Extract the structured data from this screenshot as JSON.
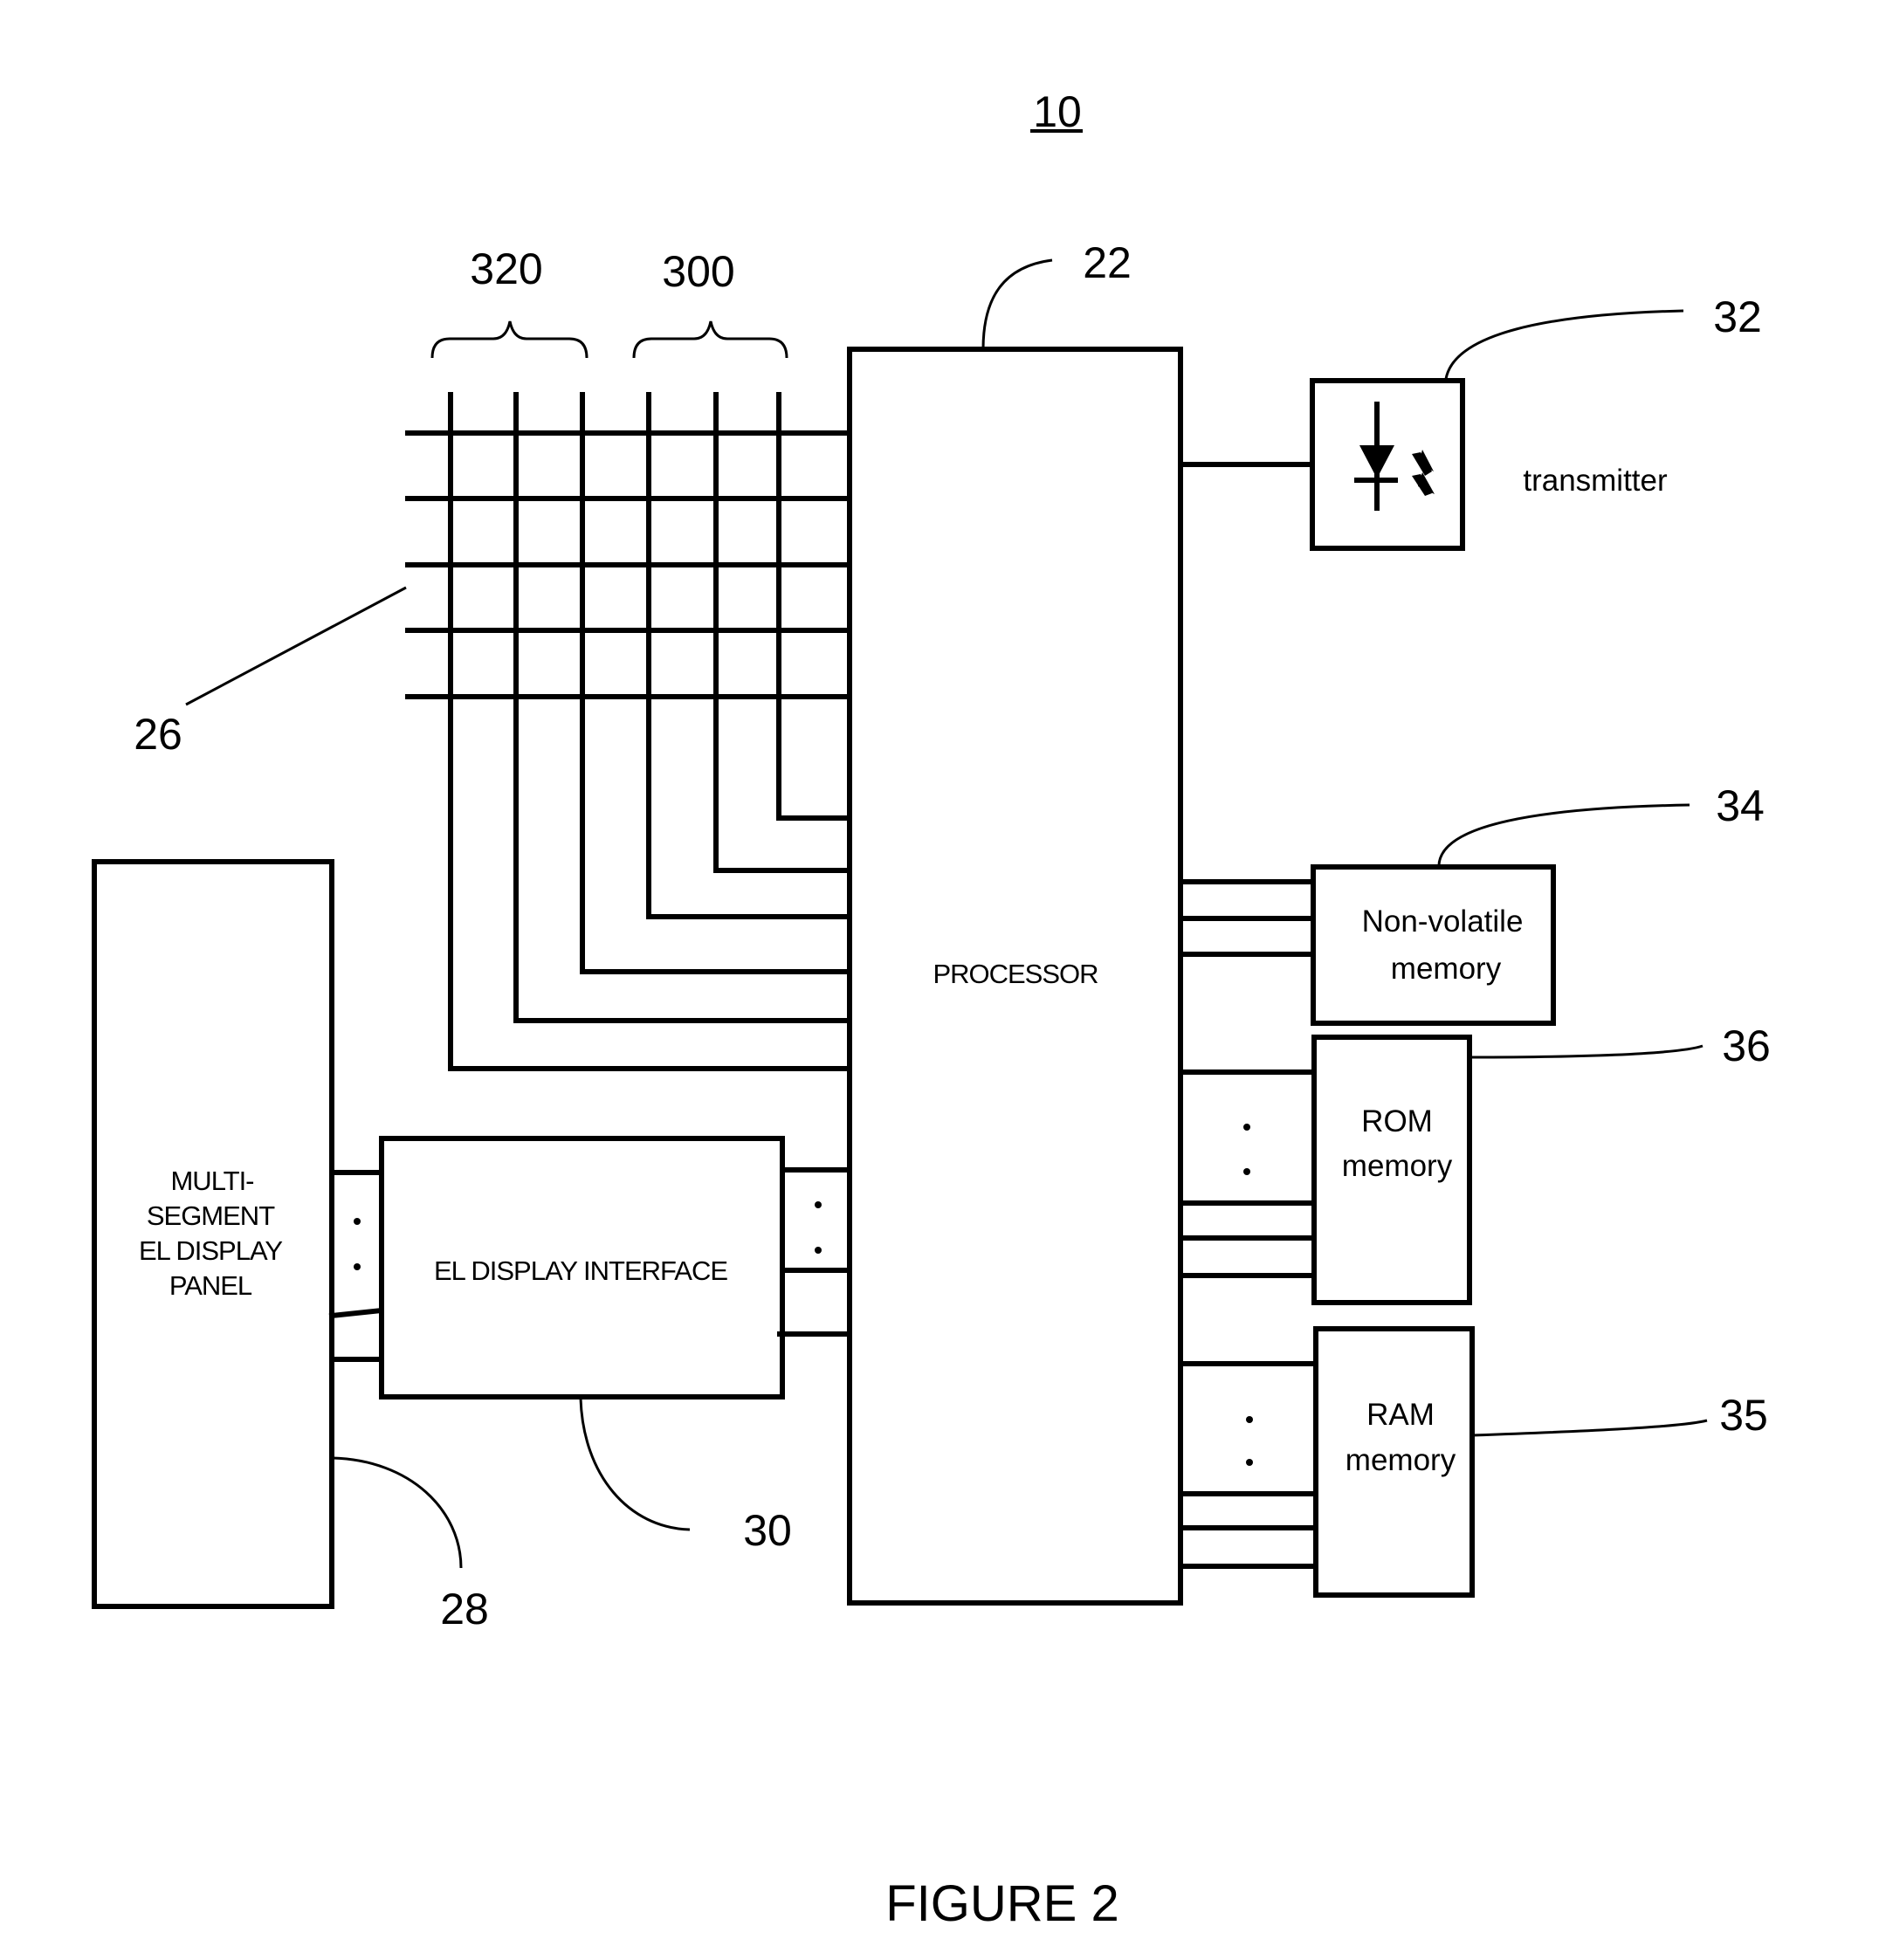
{
  "figure": {
    "reference_number": "10",
    "caption": "FIGURE 2"
  },
  "bus_groups": [
    {
      "ref": "320",
      "line_count": 3
    },
    {
      "ref": "300",
      "line_count": 3
    }
  ],
  "grid": {
    "ref": "26",
    "row_count": 5
  },
  "processor": {
    "ref": "22",
    "label": "PROCESSOR"
  },
  "transmitter": {
    "ref": "32",
    "label": "transmitter",
    "icon": "led-diode-icon"
  },
  "nonvolatile_memory": {
    "ref": "34",
    "label_lines": [
      "Non-volatile",
      "memory"
    ]
  },
  "rom_memory": {
    "ref": "36",
    "label_lines": [
      "ROM",
      "memory"
    ]
  },
  "ram_memory": {
    "ref": "35",
    "label_lines": [
      "RAM",
      "memory"
    ]
  },
  "display_panel": {
    "ref": "28",
    "label_lines": [
      "MULTI-",
      "SEGMENT",
      "EL DISPLAY",
      "PANEL"
    ]
  },
  "display_interface": {
    "ref": "30",
    "label": "EL DISPLAY INTERFACE"
  },
  "ellipsis_glyph": "·"
}
